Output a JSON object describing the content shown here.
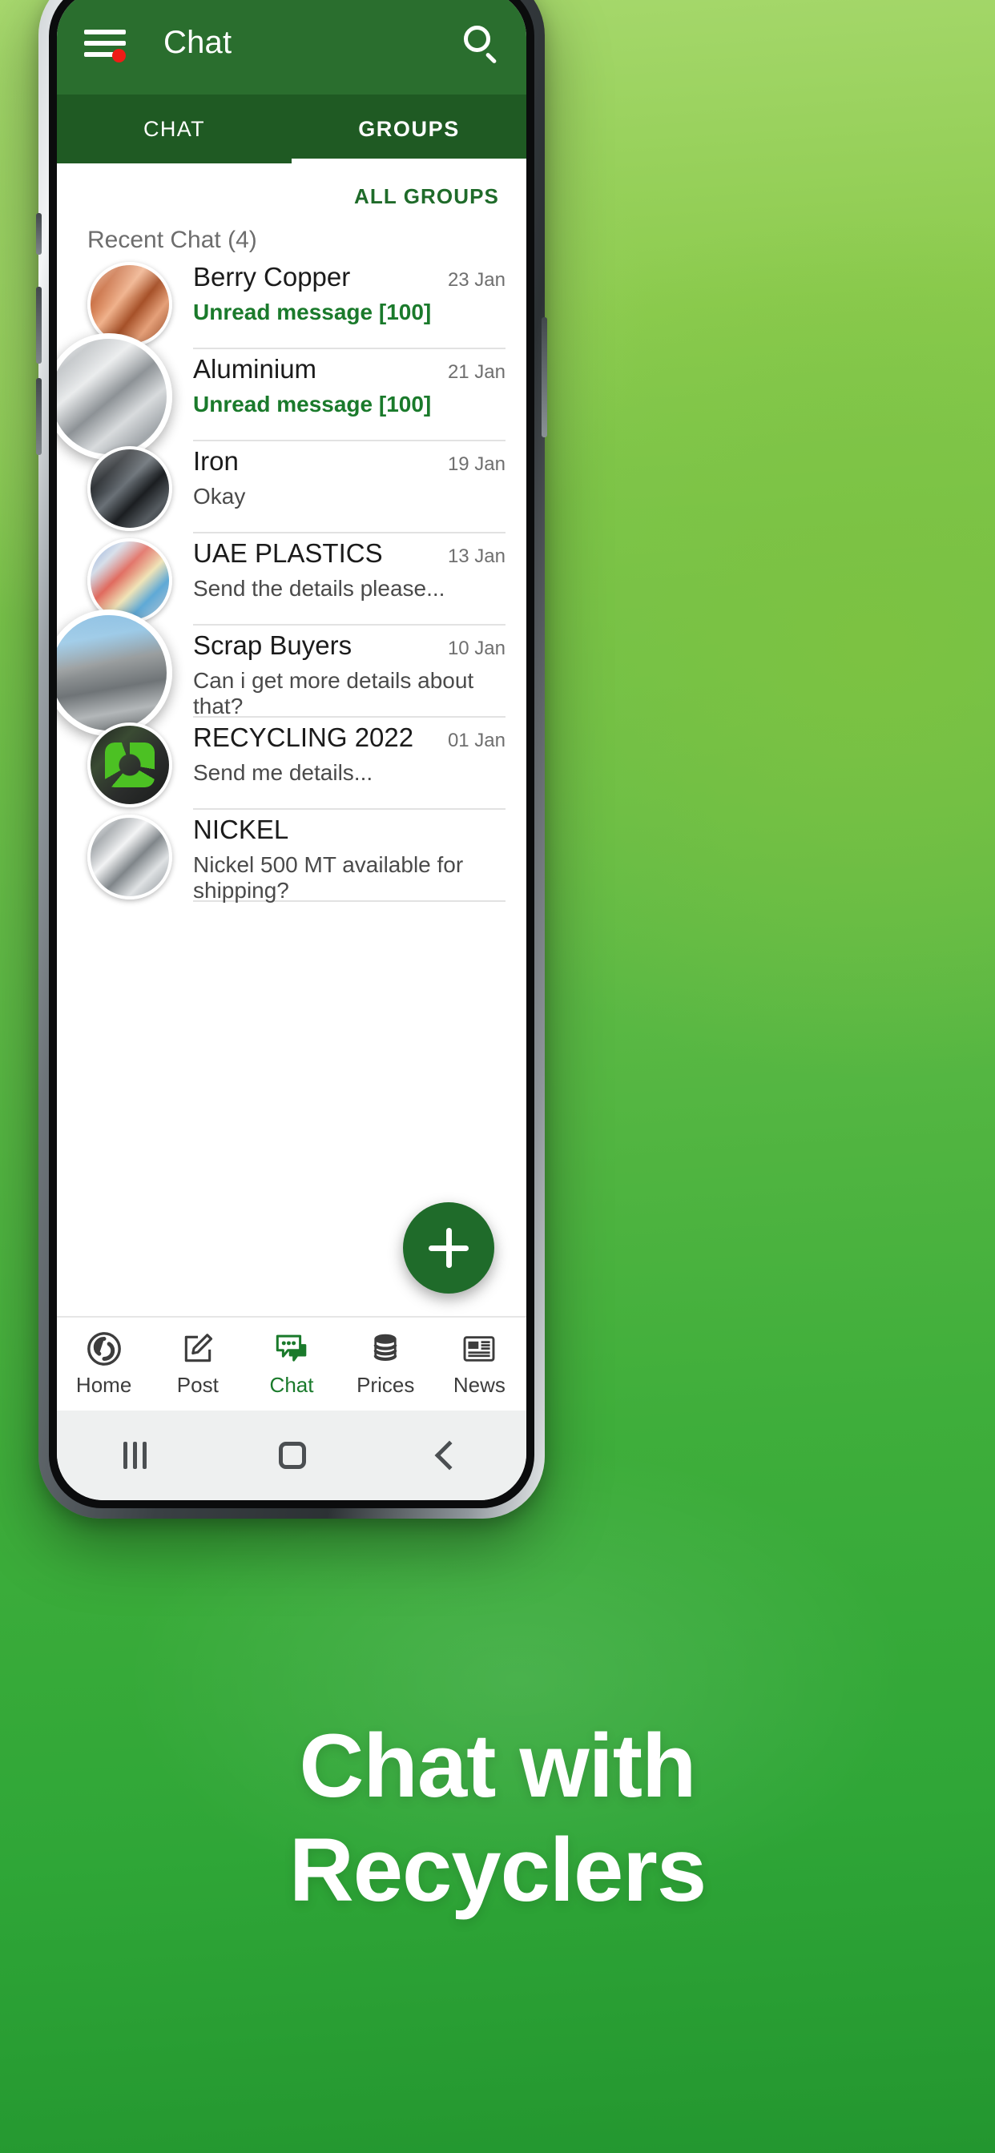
{
  "app": {
    "appbar": {
      "title": "Chat",
      "menu_icon": "hamburger-menu-icon",
      "badge_icon": "notification-dot",
      "search_icon": "search-icon"
    },
    "tabs": [
      {
        "label": "CHAT",
        "active": false
      },
      {
        "label": "GROUPS",
        "active": true
      }
    ],
    "list_header": {
      "all_groups_label": "ALL GROUPS",
      "recent_label": "Recent Chat (4)"
    },
    "chats": [
      {
        "name": "Berry Copper",
        "message": "Unread message [100]",
        "date": "23 Jan",
        "unread": true,
        "avatar": "copper-bars-avatar"
      },
      {
        "name": "Aluminium",
        "message": "Unread message [100]",
        "date": "21 Jan",
        "unread": true,
        "avatar": "aluminium-bales-avatar"
      },
      {
        "name": "Iron",
        "message": "Okay",
        "date": "19 Jan",
        "unread": false,
        "avatar": "iron-scrap-avatar"
      },
      {
        "name": "UAE PLASTICS",
        "message": "Send the details please...",
        "date": "13 Jan",
        "unread": false,
        "avatar": "plastic-waste-avatar"
      },
      {
        "name": "Scrap Buyers",
        "message": "Can i get more details about that?",
        "date": "10 Jan",
        "unread": false,
        "avatar": "scrap-yard-crane-avatar"
      },
      {
        "name": "RECYCLING 2022",
        "message": "Send me details...",
        "date": "01 Jan",
        "unread": false,
        "avatar": "recycling-symbol-avatar"
      },
      {
        "name": "NICKEL",
        "message": "Nickel 500 MT available for shipping?",
        "date": "",
        "unread": false,
        "avatar": "nickel-metal-avatar"
      }
    ],
    "fab": {
      "label": "+",
      "icon": "plus-icon"
    },
    "bottom_nav": [
      {
        "label": "Home",
        "icon": "recycle-circle-icon",
        "active": false
      },
      {
        "label": "Post",
        "icon": "edit-document-icon",
        "active": false
      },
      {
        "label": "Chat",
        "icon": "chat-bubbles-icon",
        "active": true
      },
      {
        "label": "Prices",
        "icon": "coins-stack-icon",
        "active": false
      },
      {
        "label": "News",
        "icon": "newspaper-icon",
        "active": false
      }
    ],
    "system_nav": [
      {
        "icon": "recents-icon"
      },
      {
        "icon": "home-square-icon"
      },
      {
        "icon": "back-chevron-icon"
      }
    ]
  },
  "promo": {
    "headline_line1": "Chat with",
    "headline_line2": "Recyclers",
    "accent_color": "#2a6e2e",
    "unread_color": "#1a7a2b",
    "badge_color": "#ee1c16"
  }
}
